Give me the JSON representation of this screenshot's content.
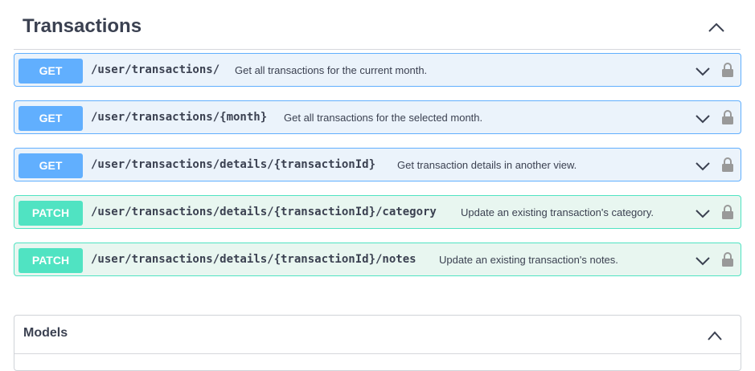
{
  "section": {
    "title": "Transactions"
  },
  "operations": [
    {
      "method": "GET",
      "path": "/user/transactions/",
      "summary": "Get all transactions for the current month."
    },
    {
      "method": "GET",
      "path": "/user/transactions/{month}",
      "summary": "Get all transactions for the selected month."
    },
    {
      "method": "GET",
      "path": "/user/transactions/details/{transactionId}",
      "summary": "Get transaction details in another view."
    },
    {
      "method": "PATCH",
      "path": "/user/transactions/details/{transactionId}/category",
      "summary": "Update an existing transaction's category."
    },
    {
      "method": "PATCH",
      "path": "/user/transactions/details/{transactionId}/notes",
      "summary": "Update an existing transaction's notes."
    }
  ],
  "models": {
    "title": "Models"
  },
  "colors": {
    "get": "#61affe",
    "patch": "#50e3c2",
    "text": "#3b4151"
  },
  "icons": {
    "expand": "chevron-down-icon",
    "collapse": "chevron-up-icon",
    "auth": "lock-icon"
  }
}
